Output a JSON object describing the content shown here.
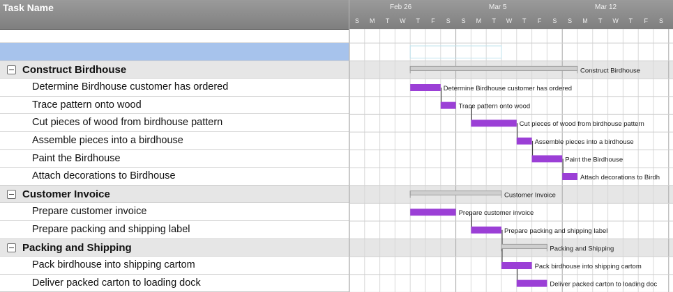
{
  "task_pane": {
    "header_title": "Task Name"
  },
  "timeline": {
    "weeks": [
      "Feb 26",
      "Mar 5",
      "Mar 12"
    ],
    "days": [
      "S",
      "M",
      "T",
      "W",
      "T",
      "F",
      "S",
      "S",
      "M",
      "T",
      "W",
      "T",
      "F",
      "S",
      "S",
      "M",
      "T",
      "W",
      "T",
      "F",
      "S"
    ]
  },
  "rows": [
    {
      "type": "blank",
      "name": ""
    },
    {
      "type": "selected",
      "name": ""
    },
    {
      "type": "group",
      "name": "Construct Birdhouse",
      "bar_label": "Construct Birdhouse",
      "start": 4,
      "end": 15
    },
    {
      "type": "task",
      "name": "Determine Birdhouse customer has ordered",
      "bar_label": "Determine Birdhouse customer has ordered",
      "start": 4,
      "end": 6
    },
    {
      "type": "task",
      "name": "Trace pattern onto wood",
      "bar_label": "Trace pattern onto wood",
      "start": 6,
      "end": 7
    },
    {
      "type": "task",
      "name": "Cut pieces of wood from birdhouse pattern",
      "bar_label": "Cut pieces of wood from birdhouse pattern",
      "start": 8,
      "end": 11
    },
    {
      "type": "task",
      "name": "Assemble pieces into a birdhouse",
      "bar_label": "Assemble pieces into a birdhouse",
      "start": 11,
      "end": 12
    },
    {
      "type": "task",
      "name": "Paint the Birdhouse",
      "bar_label": "Paint the Birdhouse",
      "start": 12,
      "end": 14
    },
    {
      "type": "task",
      "name": "Attach decorations to Birdhouse",
      "bar_label": "Attach decorations to Birdh",
      "start": 14,
      "end": 15
    },
    {
      "type": "group",
      "name": "Customer Invoice",
      "bar_label": "Customer Invoice",
      "start": 4,
      "end": 10
    },
    {
      "type": "task",
      "name": "Prepare customer invoice",
      "bar_label": "Prepare customer invoice",
      "start": 4,
      "end": 7
    },
    {
      "type": "task",
      "name": "Prepare packing and shipping label",
      "bar_label": "Prepare packing and shipping label",
      "start": 8,
      "end": 10
    },
    {
      "type": "group",
      "name": "Packing and Shipping",
      "bar_label": "Packing and Shipping",
      "start": 10,
      "end": 13
    },
    {
      "type": "task",
      "name": "Pack birdhouse into shipping cartom",
      "bar_label": "Pack birdhouse into shipping cartom",
      "start": 10,
      "end": 12
    },
    {
      "type": "task",
      "name": "Deliver packed carton to loading dock",
      "bar_label": "Deliver packed carton to loading doc",
      "start": 11,
      "end": 13
    }
  ],
  "dependencies": [
    [
      3,
      4
    ],
    [
      4,
      5
    ],
    [
      5,
      6
    ],
    [
      6,
      7
    ],
    [
      7,
      8
    ],
    [
      10,
      11
    ],
    [
      11,
      13
    ],
    [
      13,
      14
    ]
  ],
  "colors": {
    "task_bar": "#9b3fd6",
    "summary_bar": "#cfcfcf",
    "grid": "#d8d8d8",
    "week_line": "#a9a9a9",
    "connector": "#2d2d2d"
  }
}
